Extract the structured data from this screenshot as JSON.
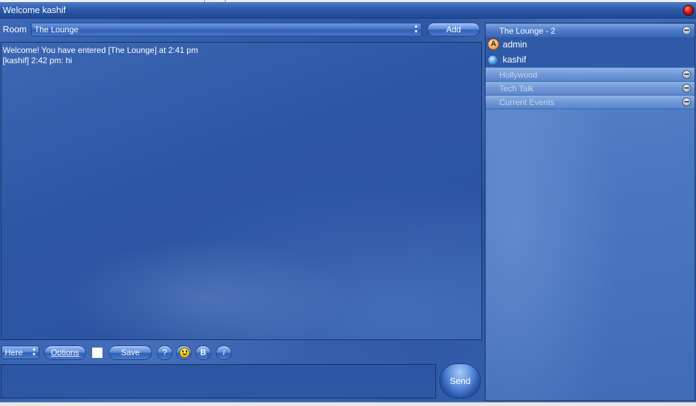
{
  "window": {
    "title": "Welcome kashif"
  },
  "room_bar": {
    "label": "Room",
    "selected_room": "The Lounge",
    "add_label": "Add"
  },
  "chat": {
    "messages": [
      "Welcome! You have entered [The Lounge] at 2:41 pm",
      "[kashif] 2:42 pm: hi"
    ]
  },
  "rooms": [
    {
      "name": "The Lounge - 2",
      "active": true,
      "users": [
        "admin",
        "kashif"
      ]
    },
    {
      "name": "Hollywood",
      "active": false
    },
    {
      "name": "Tech Talk",
      "active": false
    },
    {
      "name": "Current Events",
      "active": false
    }
  ],
  "toolbar": {
    "status_value": "Here",
    "options_label": "Options",
    "text_color": "#ffffff",
    "save_label": "Save",
    "help_label": "?",
    "bold_label": "B",
    "italic_label": "i"
  },
  "composer": {
    "message_value": "",
    "send_label": "Send"
  },
  "icons": {
    "close": "close-icon",
    "admin_user": "admin-badge-icon",
    "user": "user-status-icon",
    "collapse": "collapse-icon",
    "smiley": "smiley-icon"
  },
  "colors": {
    "accent": "#2d58a6",
    "close": "#d01515",
    "text": "#ffffff"
  }
}
